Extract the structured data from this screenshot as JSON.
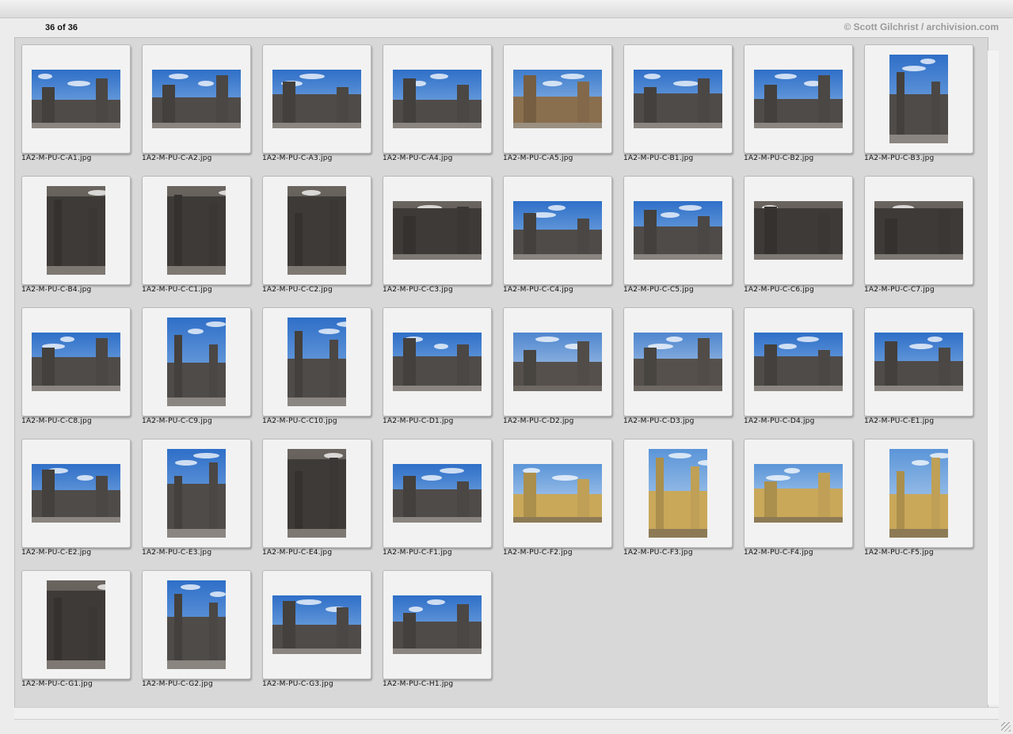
{
  "window": {
    "count_label": "36 of 36",
    "credit": "© Scott Gilchrist / archivision.com"
  },
  "colors": {
    "panel_bg": "#d8d8d8",
    "slide_bg": "#f2f2f2",
    "sky": "#3f7fd0",
    "stone": "#5d5a57"
  },
  "thumbnails": [
    {
      "filename": "1A2-M-PU-C-A1.jpg",
      "orientation": "landscape",
      "palette": "sky"
    },
    {
      "filename": "1A2-M-PU-C-A2.jpg",
      "orientation": "landscape",
      "palette": "sky"
    },
    {
      "filename": "1A2-M-PU-C-A3.jpg",
      "orientation": "landscape",
      "palette": "sky"
    },
    {
      "filename": "1A2-M-PU-C-A4.jpg",
      "orientation": "landscape",
      "palette": "sky"
    },
    {
      "filename": "1A2-M-PU-C-A5.jpg",
      "orientation": "landscape",
      "palette": "warm"
    },
    {
      "filename": "1A2-M-PU-C-B1.jpg",
      "orientation": "landscape",
      "palette": "sky"
    },
    {
      "filename": "1A2-M-PU-C-B2.jpg",
      "orientation": "landscape",
      "palette": "sky"
    },
    {
      "filename": "1A2-M-PU-C-B3.jpg",
      "orientation": "portrait",
      "palette": "sky"
    },
    {
      "filename": "1A2-M-PU-C-B4.jpg",
      "orientation": "portrait",
      "palette": "stone"
    },
    {
      "filename": "1A2-M-PU-C-C1.jpg",
      "orientation": "portrait",
      "palette": "stone"
    },
    {
      "filename": "1A2-M-PU-C-C2.jpg",
      "orientation": "portrait",
      "palette": "stone"
    },
    {
      "filename": "1A2-M-PU-C-C3.jpg",
      "orientation": "landscape",
      "palette": "stone"
    },
    {
      "filename": "1A2-M-PU-C-C4.jpg",
      "orientation": "landscape",
      "palette": "sky"
    },
    {
      "filename": "1A2-M-PU-C-C5.jpg",
      "orientation": "landscape",
      "palette": "sky"
    },
    {
      "filename": "1A2-M-PU-C-C6.jpg",
      "orientation": "landscape",
      "palette": "stone"
    },
    {
      "filename": "1A2-M-PU-C-C7.jpg",
      "orientation": "landscape",
      "palette": "stone"
    },
    {
      "filename": "1A2-M-PU-C-C8.jpg",
      "orientation": "landscape",
      "palette": "sky"
    },
    {
      "filename": "1A2-M-PU-C-C9.jpg",
      "orientation": "portrait",
      "palette": "sky"
    },
    {
      "filename": "1A2-M-PU-C-C10.jpg",
      "orientation": "portrait",
      "palette": "sky"
    },
    {
      "filename": "1A2-M-PU-C-D1.jpg",
      "orientation": "landscape",
      "palette": "sky"
    },
    {
      "filename": "1A2-M-PU-C-D2.jpg",
      "orientation": "landscape",
      "palette": "dome"
    },
    {
      "filename": "1A2-M-PU-C-D3.jpg",
      "orientation": "landscape",
      "palette": "dome"
    },
    {
      "filename": "1A2-M-PU-C-D4.jpg",
      "orientation": "landscape",
      "palette": "sky"
    },
    {
      "filename": "1A2-M-PU-C-E1.jpg",
      "orientation": "landscape",
      "palette": "sky"
    },
    {
      "filename": "1A2-M-PU-C-E2.jpg",
      "orientation": "landscape",
      "palette": "sky"
    },
    {
      "filename": "1A2-M-PU-C-E3.jpg",
      "orientation": "portrait",
      "palette": "sky"
    },
    {
      "filename": "1A2-M-PU-C-E4.jpg",
      "orientation": "portrait",
      "palette": "stone"
    },
    {
      "filename": "1A2-M-PU-C-F1.jpg",
      "orientation": "landscape",
      "palette": "sky"
    },
    {
      "filename": "1A2-M-PU-C-F2.jpg",
      "orientation": "landscape",
      "palette": "yellow"
    },
    {
      "filename": "1A2-M-PU-C-F3.jpg",
      "orientation": "portrait",
      "palette": "yellow"
    },
    {
      "filename": "1A2-M-PU-C-F4.jpg",
      "orientation": "landscape",
      "palette": "yellow"
    },
    {
      "filename": "1A2-M-PU-C-F5.jpg",
      "orientation": "portrait",
      "palette": "yellow"
    },
    {
      "filename": "1A2-M-PU-C-G1.jpg",
      "orientation": "portrait",
      "palette": "stone"
    },
    {
      "filename": "1A2-M-PU-C-G2.jpg",
      "orientation": "portrait",
      "palette": "sky"
    },
    {
      "filename": "1A2-M-PU-C-G3.jpg",
      "orientation": "landscape",
      "palette": "sky"
    },
    {
      "filename": "1A2-M-PU-C-H1.jpg",
      "orientation": "landscape",
      "palette": "sky"
    }
  ]
}
